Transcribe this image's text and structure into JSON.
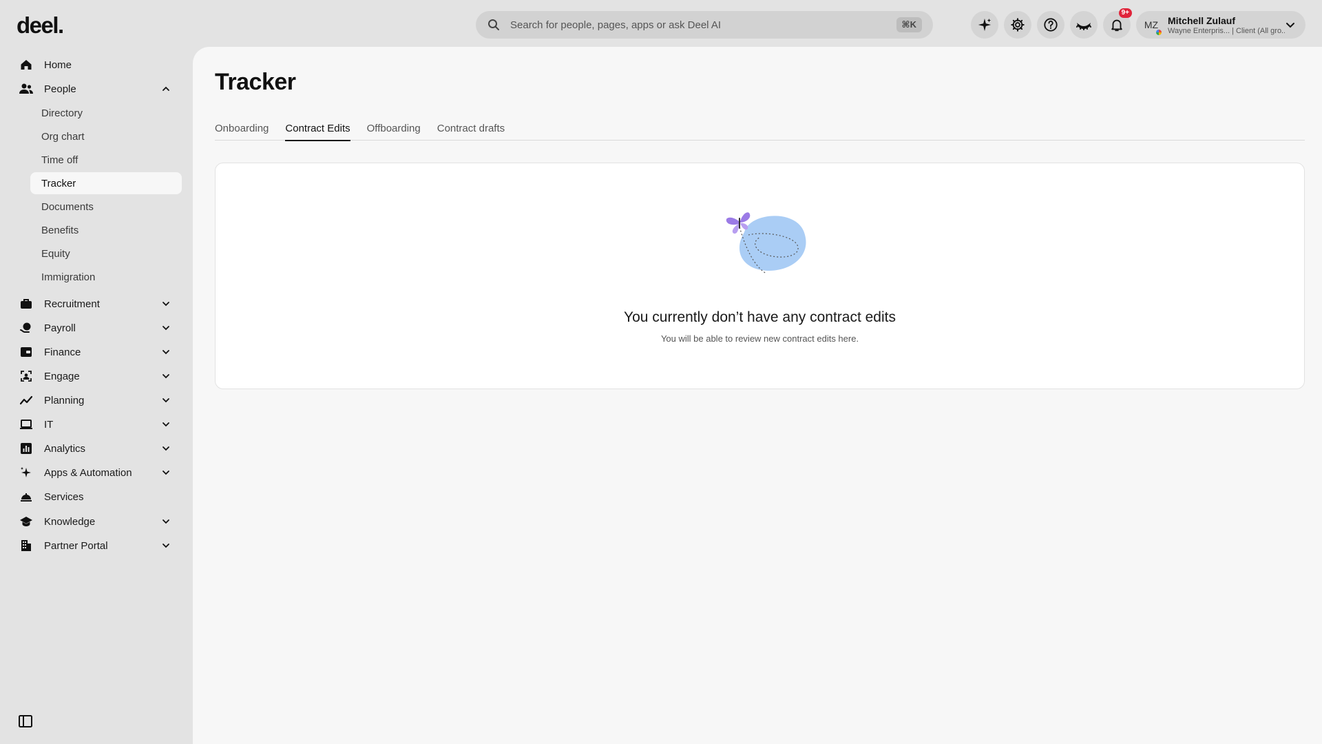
{
  "app": {
    "logo": "deel."
  },
  "search": {
    "placeholder": "Search for people, pages, apps or ask Deel AI",
    "shortcut": "⌘K"
  },
  "topbar": {
    "notifications_badge": "9+"
  },
  "profile": {
    "initials": "MZ",
    "name": "Mitchell Zulauf",
    "subtitle": "Wayne Enterpris... | Client (All gro..."
  },
  "sidebar": {
    "home": "Home",
    "people": "People",
    "people_items": [
      "Directory",
      "Org chart",
      "Time off",
      "Tracker",
      "Documents",
      "Benefits",
      "Equity",
      "Immigration"
    ],
    "recruitment": "Recruitment",
    "payroll": "Payroll",
    "finance": "Finance",
    "engage": "Engage",
    "planning": "Planning",
    "it": "IT",
    "analytics": "Analytics",
    "apps": "Apps & Automation",
    "services": "Services",
    "knowledge": "Knowledge",
    "partner": "Partner Portal"
  },
  "page": {
    "title": "Tracker",
    "tabs": [
      "Onboarding",
      "Contract Edits",
      "Offboarding",
      "Contract drafts"
    ],
    "empty_title": "You currently don’t have any contract edits",
    "empty_subtitle": "You will be able to review new contract edits here."
  },
  "colors": {
    "accent": "#111111",
    "badge": "#e0243a",
    "illustration_blob": "#aacdf5",
    "butterfly": "#9b7be6"
  }
}
